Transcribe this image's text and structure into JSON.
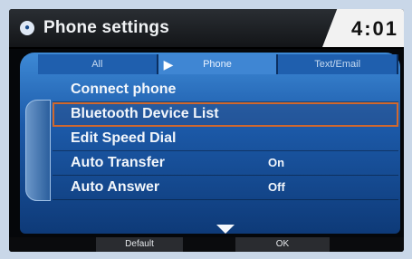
{
  "header": {
    "title": "Phone settings",
    "clock": "4:01",
    "icon": "phone-menu-icon"
  },
  "tabs": [
    {
      "label": "All"
    },
    {
      "label": "Phone",
      "active": true
    },
    {
      "label": "Text/Email"
    }
  ],
  "menu": [
    {
      "label": "Connect phone",
      "value": ""
    },
    {
      "label": "Bluetooth Device List",
      "value": "",
      "selected": true
    },
    {
      "label": "Edit Speed Dial",
      "value": ""
    },
    {
      "label": "Auto Transfer",
      "value": "On"
    },
    {
      "label": "Auto Answer",
      "value": "Off"
    }
  ],
  "footer": {
    "default_label": "Default",
    "ok_label": "OK"
  },
  "colors": {
    "panel_blue": "#1c5aa9",
    "selection_outline": "#d0682e",
    "frame_bg": "#c9d7e8"
  }
}
